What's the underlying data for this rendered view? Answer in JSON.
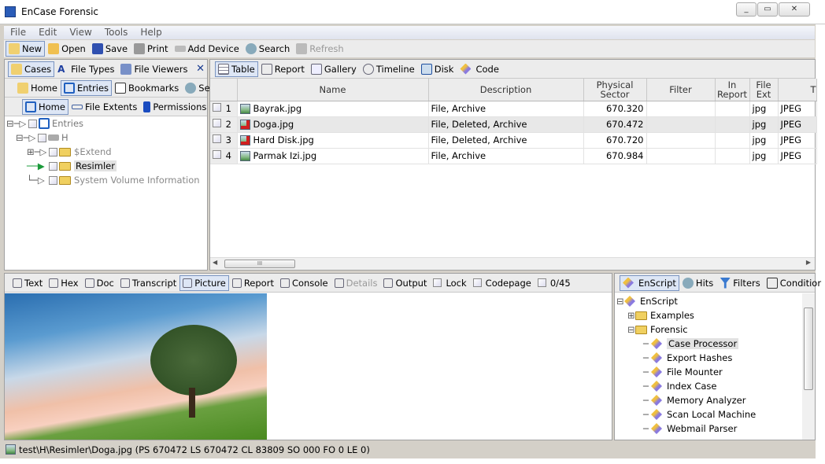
{
  "window": {
    "title": "EnCase Forensic"
  },
  "menu": [
    "File",
    "Edit",
    "View",
    "Tools",
    "Help"
  ],
  "toolbar": [
    {
      "label": "New",
      "selected": true
    },
    {
      "label": "Open"
    },
    {
      "label": "Save"
    },
    {
      "label": "Print"
    },
    {
      "label": "Add Device"
    },
    {
      "label": "Search"
    },
    {
      "label": "Refresh",
      "disabled": true
    }
  ],
  "left_pane": {
    "tabs": [
      "Cases",
      "File Types",
      "File Viewers"
    ],
    "subtabs": [
      "Home",
      "Entries",
      "Bookmarks",
      "Se"
    ],
    "subtabs2": [
      "Home",
      "File Extents",
      "Permissions"
    ],
    "tree": [
      {
        "label": "Entries"
      },
      {
        "label": "H"
      },
      {
        "label": "$Extend"
      },
      {
        "label": "Resimler",
        "selected": true
      },
      {
        "label": "System Volume Information"
      }
    ]
  },
  "right_pane": {
    "views": [
      "Table",
      "Report",
      "Gallery",
      "Timeline",
      "Disk",
      "Code"
    ],
    "columns": [
      "Name",
      "Description",
      "Physical Sector",
      "Filter",
      "In Report",
      "File Ext",
      "T"
    ],
    "rows": [
      {
        "n": "1",
        "name": "Bayrak.jpg",
        "desc": "File, Archive",
        "sector": "670.320",
        "filter": "",
        "report": "",
        "ext": "jpg",
        "type": "JPEG",
        "deleted": false
      },
      {
        "n": "2",
        "name": "Doga.jpg",
        "desc": "File, Deleted, Archive",
        "sector": "670.472",
        "filter": "",
        "report": "",
        "ext": "jpg",
        "type": "JPEG",
        "deleted": true
      },
      {
        "n": "3",
        "name": "Hard Disk.jpg",
        "desc": "File, Deleted, Archive",
        "sector": "670.720",
        "filter": "",
        "report": "",
        "ext": "jpg",
        "type": "JPEG",
        "deleted": true
      },
      {
        "n": "4",
        "name": "Parmak Izi.jpg",
        "desc": "File, Archive",
        "sector": "670.984",
        "filter": "",
        "report": "",
        "ext": "jpg",
        "type": "JPEG",
        "deleted": false
      }
    ],
    "scroll_grip": "III"
  },
  "bottom_pane": {
    "views": [
      "Text",
      "Hex",
      "Doc",
      "Transcript",
      "Picture",
      "Report",
      "Console",
      "Details",
      "Output"
    ],
    "checks": [
      "Lock",
      "Codepage",
      "0/45"
    ]
  },
  "script_pane": {
    "tabs": [
      "EnScript",
      "Hits",
      "Filters",
      "Conditior"
    ],
    "tree": [
      "EnScript",
      "Examples",
      "Forensic",
      "Case Processor",
      "Export Hashes",
      "File Mounter",
      "Index Case",
      "Memory Analyzer",
      "Scan Local Machine",
      "Webmail Parser"
    ]
  },
  "status": "test\\H\\Resimler\\Doga.jpg (PS 670472  LS 670472  CL 83809  SO 000  FO 0  LE 0)"
}
